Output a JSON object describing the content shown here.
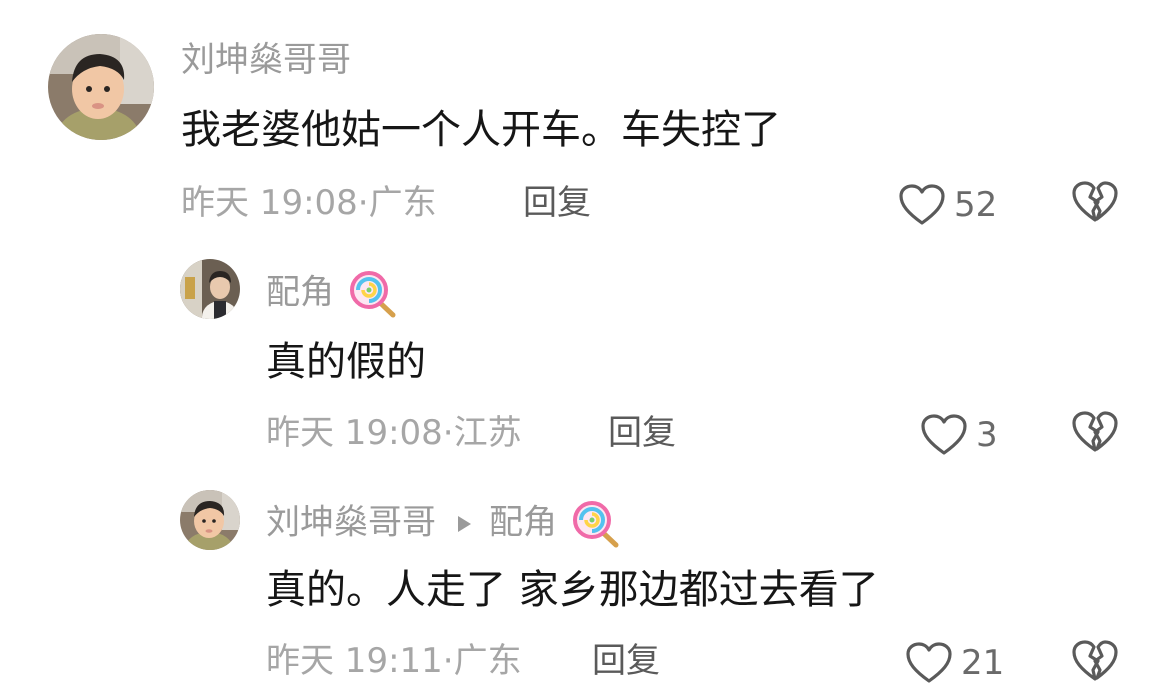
{
  "comments": [
    {
      "username": "刘坤燊哥哥",
      "text": "我老婆他姑一个人开车。车失控了",
      "time": "昨天 19:08",
      "location": "广东",
      "reply_label": "回复",
      "likes": "52"
    }
  ],
  "replies": [
    {
      "username": "配角",
      "text": "真的假的",
      "time": "昨天 19:08",
      "location": "江苏",
      "reply_label": "回复",
      "likes": "3"
    },
    {
      "username": "刘坤燊哥哥",
      "reply_to": "配角",
      "text": "真的。人走了  家乡那边都过去看了",
      "time": "昨天 19:11",
      "location": "广东",
      "reply_label": "回复",
      "likes": "21"
    }
  ],
  "meta_separator": "·",
  "colors": {
    "text": "#161616",
    "muted": "#9a9a9a",
    "icon": "#5a5a5a"
  }
}
